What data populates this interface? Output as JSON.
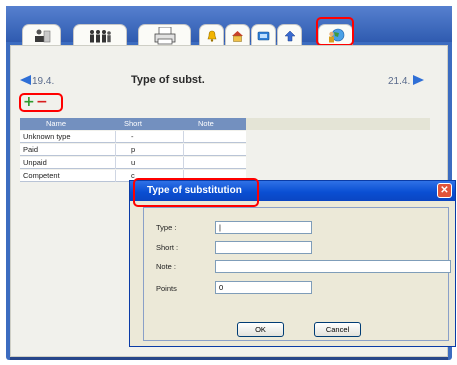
{
  "toolbar": {
    "tabs": [
      {
        "icon": "calculator-user-icon"
      },
      {
        "icon": "people-group-icon"
      },
      {
        "icon": "printer-icon"
      },
      {
        "icon": "bell-icon"
      },
      {
        "icon": "house-icon"
      },
      {
        "icon": "book-icon"
      },
      {
        "icon": "up-arrow-icon"
      },
      {
        "icon": "globe-person-icon"
      }
    ]
  },
  "nav": {
    "prev_label": "19.4.",
    "next_label": "21.4."
  },
  "page_title": "Type of subst.",
  "controls": {
    "add": "+",
    "remove": "−"
  },
  "table": {
    "columns": [
      "Name",
      "Short",
      "Note"
    ],
    "rows": [
      {
        "name": "Unknown type",
        "short": "-",
        "note": ""
      },
      {
        "name": "Paid",
        "short": "p",
        "note": ""
      },
      {
        "name": "Unpaid",
        "short": "u",
        "note": ""
      },
      {
        "name": "Competent",
        "short": "c",
        "note": ""
      }
    ]
  },
  "dialog": {
    "title": "Type of substitution",
    "close": "✕",
    "fields": {
      "type": {
        "label": "Type :",
        "value": "|"
      },
      "short": {
        "label": "Short :",
        "value": ""
      },
      "note": {
        "label": "Note :",
        "value": ""
      },
      "points": {
        "label": "Points",
        "value": "0"
      }
    },
    "ok": "OK",
    "cancel": "Cancel"
  },
  "colors": {
    "frame_blue": "#3c6cc0",
    "highlight_red": "#ff0000",
    "add_green": "#2e9a2e",
    "remove_red": "#d81e1e",
    "nav_blue": "#2f6fd6"
  }
}
